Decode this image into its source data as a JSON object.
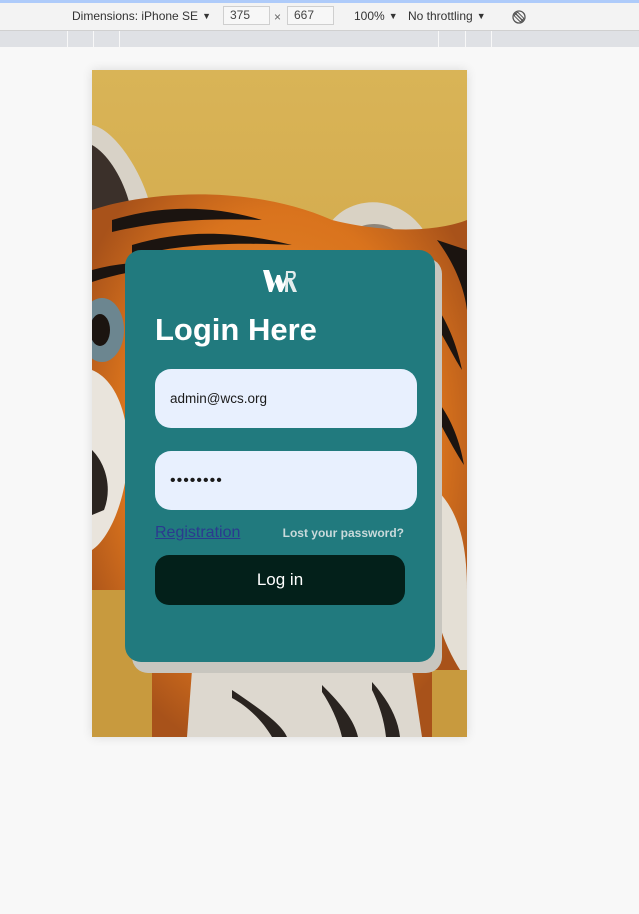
{
  "devtools": {
    "dimensions_label": "Dimensions: iPhone SE",
    "width": "375",
    "times": "×",
    "height": "667",
    "zoom": "100%",
    "throttling": "No throttling",
    "caret": "▼"
  },
  "login": {
    "title": "Login Here",
    "email_value": "admin@wcs.org",
    "password_value": "password",
    "registration_link": "Registration",
    "lost_password_link": "Lost your password?",
    "login_button": "Log in"
  },
  "colors": {
    "card": "#217a7e",
    "field": "#e8f0fe",
    "button": "#03201a",
    "link": "#2b3a8f"
  }
}
